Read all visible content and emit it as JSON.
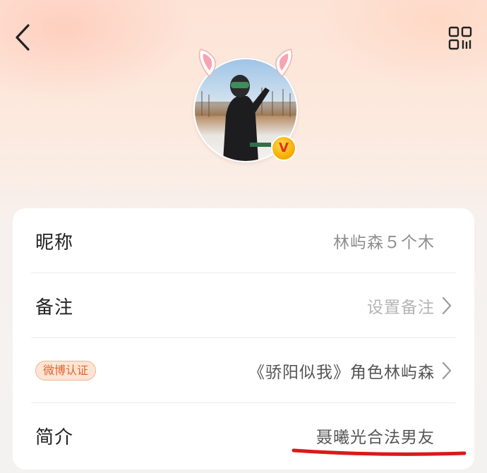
{
  "header": {
    "back_icon": "chevron-left-icon",
    "qr_icon": "qr-code-icon"
  },
  "avatar": {
    "badge_label": "V",
    "decoration": "bunny-ears",
    "badge_color": "#f6a800"
  },
  "profile": {
    "rows": [
      {
        "label": "昵称",
        "value": "林屿森５个木"
      },
      {
        "label": "备注",
        "value": "设置备注"
      },
      {
        "tag": "微博认证",
        "value": "《骄阳似我》角色林屿森"
      },
      {
        "label": "简介",
        "value": "聂曦光合法男友"
      }
    ]
  },
  "colors": {
    "accent_underline": "#d91a1a",
    "tag_text": "#e0652f",
    "tag_bg": "#fde4d4"
  }
}
